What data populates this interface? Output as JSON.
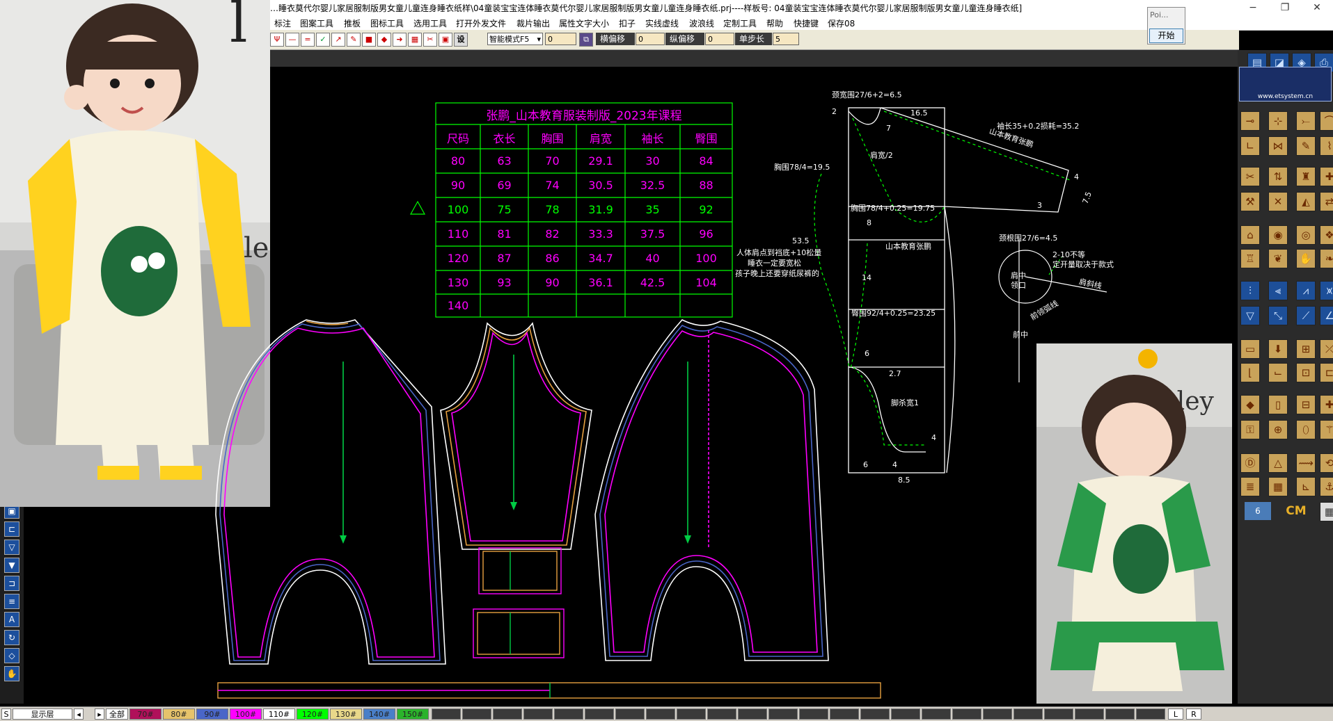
{
  "window": {
    "title": "…睡衣莫代尔婴儿家居服制版男女童儿童连身睡衣纸样\\04童装宝宝连体睡衣莫代尔婴儿家居服制版男女童儿童连身睡衣纸.prj----样板号: 04童装宝宝连体睡衣莫代尔婴儿家居服制版男女童儿童连身睡衣纸]",
    "minimize": "−",
    "restore": "❐",
    "close": "✕"
  },
  "popup": {
    "title": "Poi...",
    "button": "开始"
  },
  "menu": [
    "标注",
    "图案工具",
    "推板",
    "图标工具",
    "选用工具",
    "打开外发文件",
    "裁片输出",
    "属性文字大小",
    "扣子",
    "实线虚线",
    "波浪线",
    "定制工具",
    "帮助",
    "快捷键",
    "保存08"
  ],
  "toolbar": {
    "setting_label": "设",
    "mode_select": "智能模式F5",
    "value1": "0",
    "h_offset_label": "横偏移",
    "h_offset": "0",
    "v_offset_label": "纵偏移",
    "v_offset": "0",
    "step_label": "单步长",
    "step": "5"
  },
  "size_table": {
    "title": "张鹏_山本教育服装制版_2023年课程",
    "headers": [
      "尺码",
      "衣长",
      "胸围",
      "肩宽",
      "袖长",
      "臀围"
    ],
    "rows": [
      [
        "80",
        "63",
        "70",
        "29.1",
        "30",
        "84"
      ],
      [
        "90",
        "69",
        "74",
        "30.5",
        "32.5",
        "88"
      ],
      [
        "100",
        "75",
        "78",
        "31.9",
        "35",
        "92"
      ],
      [
        "110",
        "81",
        "82",
        "33.3",
        "37.5",
        "96"
      ],
      [
        "120",
        "87",
        "86",
        "34.7",
        "40",
        "100"
      ],
      [
        "130",
        "93",
        "90",
        "36.1",
        "42.5",
        "104"
      ],
      [
        "140",
        "",
        "",
        "",
        "",
        ""
      ]
    ]
  },
  "annotations": {
    "neck_width": "颈宽围27/6+2=6.5",
    "n2": "2",
    "n16_5": "16.5",
    "sleeve_len": "袖长35+0.2损耗=35.2",
    "school1": "山本教育张鹏",
    "n4": "4",
    "n7_5": "7.5",
    "n3": "3",
    "shoulder": "肩宽/2",
    "n7": "7",
    "chest_line": "胸围78/4=19.5",
    "chest_calc": "胸围78/4+0.25=19.75",
    "n8": "8",
    "n53_5": "53.5",
    "note1": "人体肩点到裆底+10松量",
    "note2": "睡衣一定要宽松",
    "note3": "孩子晚上还要穿纸尿裤的",
    "n14": "14",
    "school2": "山本教育张鹏",
    "hip": "臀围92/4+0.25=23.25",
    "n6": "6",
    "n2_7": "2.7",
    "crotch": "脚杀宽1",
    "n4b": "4",
    "n6b": "6",
    "n4c": "4",
    "n8_5": "8.5",
    "neck2": "颈根围27/6=4.5",
    "n2_10": "2-10不等",
    "style_note": "定开量取决于款式",
    "shoulder_line": "肩斜线",
    "collar1": "肩中",
    "collar2": "领口",
    "neck_curve": "前领弧线",
    "front_center": "前中"
  },
  "right_panel": {
    "url": "www.etsystem.cn",
    "unit_value": "6",
    "unit": "CM"
  },
  "layer_bar": {
    "s_label": "S",
    "display_layer": "显示层",
    "all": "全部",
    "layers": [
      {
        "label": "70#",
        "color": "#b0105a"
      },
      {
        "label": "80#",
        "color": "#e6c36b"
      },
      {
        "label": "90#",
        "color": "#4a66c8"
      },
      {
        "label": "100#",
        "color": "#ff00ff"
      },
      {
        "label": "110#",
        "color": "#ffffff"
      },
      {
        "label": "120#",
        "color": "#00ff00"
      },
      {
        "label": "130#",
        "color": "#e8d88a"
      },
      {
        "label": "140#",
        "color": "#4a7fc8"
      },
      {
        "label": "150#",
        "color": "#2bb32b"
      }
    ],
    "l": "L",
    "r": "R"
  },
  "colors": {
    "canvas": "#000000",
    "table_line": "#00ff00",
    "table_text": "#ff00ff",
    "pattern_white": "#ffffff"
  }
}
